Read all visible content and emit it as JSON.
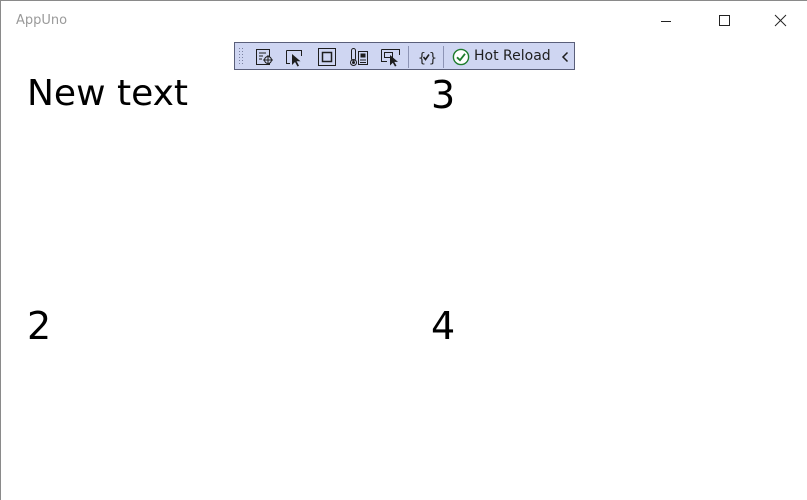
{
  "window": {
    "title": "AppUno"
  },
  "toolbar": {
    "hot_reload_label": "Hot Reload",
    "icons": [
      "live-visual-tree-icon",
      "select-element-icon",
      "display-layout-adorners-icon",
      "track-focused-element-icon",
      "display-layout-icon",
      "xaml-binding-failures-icon"
    ]
  },
  "grid": {
    "cell_top_left": "New text",
    "cell_top_right": "3",
    "cell_bottom_left": "2",
    "cell_bottom_right": "4"
  }
}
